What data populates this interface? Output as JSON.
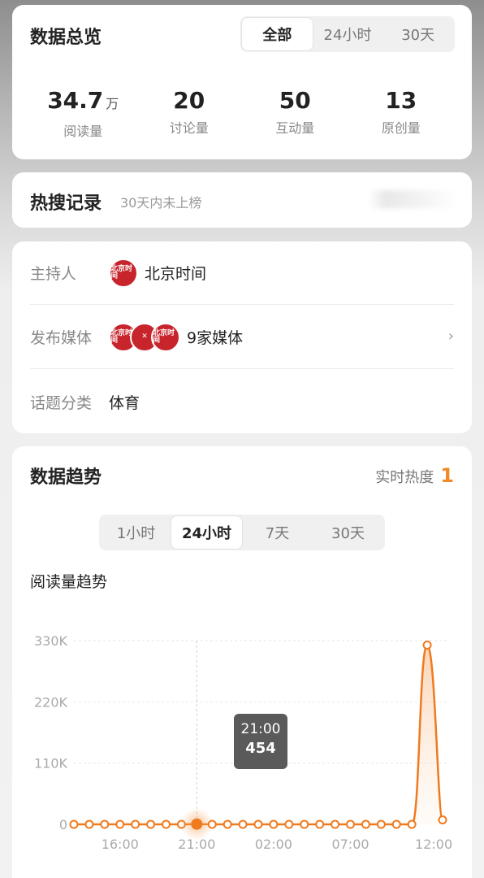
{
  "overview": {
    "title": "数据总览",
    "tabs": [
      {
        "label": "全部",
        "active": true
      },
      {
        "label": "24小时"
      },
      {
        "label": "30天"
      }
    ],
    "stats": [
      {
        "value": "34.7",
        "unit": "万",
        "label": "阅读量"
      },
      {
        "value": "20",
        "unit": "",
        "label": "讨论量"
      },
      {
        "value": "50",
        "unit": "",
        "label": "互动量"
      },
      {
        "value": "13",
        "unit": "",
        "label": "原创量"
      }
    ]
  },
  "hot_search": {
    "title": "热搜记录",
    "note": "30天内未上榜"
  },
  "info": {
    "host_label": "主持人",
    "host_name": "北京时间",
    "media_label": "发布媒体",
    "media_count": "9家媒体",
    "category_label": "话题分类",
    "category": "体育",
    "logo_text": "北京时间"
  },
  "trend": {
    "title": "数据趋势",
    "realtime_label": "实时热度",
    "realtime_value": "1",
    "tabs": [
      {
        "label": "1小时"
      },
      {
        "label": "24小时",
        "active": true
      },
      {
        "label": "7天"
      },
      {
        "label": "30天"
      }
    ],
    "chart_label": "阅读量趋势",
    "tooltip": {
      "time": "21:00",
      "value": "454"
    }
  },
  "colors": {
    "accent": "#f08a24",
    "line": "#f07a1e"
  },
  "chart_data": {
    "type": "line",
    "title": "阅读量趋势",
    "y_ticks": [
      "0",
      "110K",
      "220K",
      "330K"
    ],
    "ylim": [
      0,
      330000
    ],
    "x_ticks": [
      "16:00",
      "21:00",
      "02:00",
      "07:00",
      "12:00"
    ],
    "series": [
      {
        "values": [
          0,
          0,
          0,
          0,
          0,
          0,
          0,
          0,
          454,
          0,
          0,
          0,
          0,
          0,
          0,
          0,
          0,
          0,
          0,
          0,
          0,
          0,
          0,
          322000,
          8000
        ]
      }
    ],
    "highlight_index": 8,
    "grid": true
  }
}
